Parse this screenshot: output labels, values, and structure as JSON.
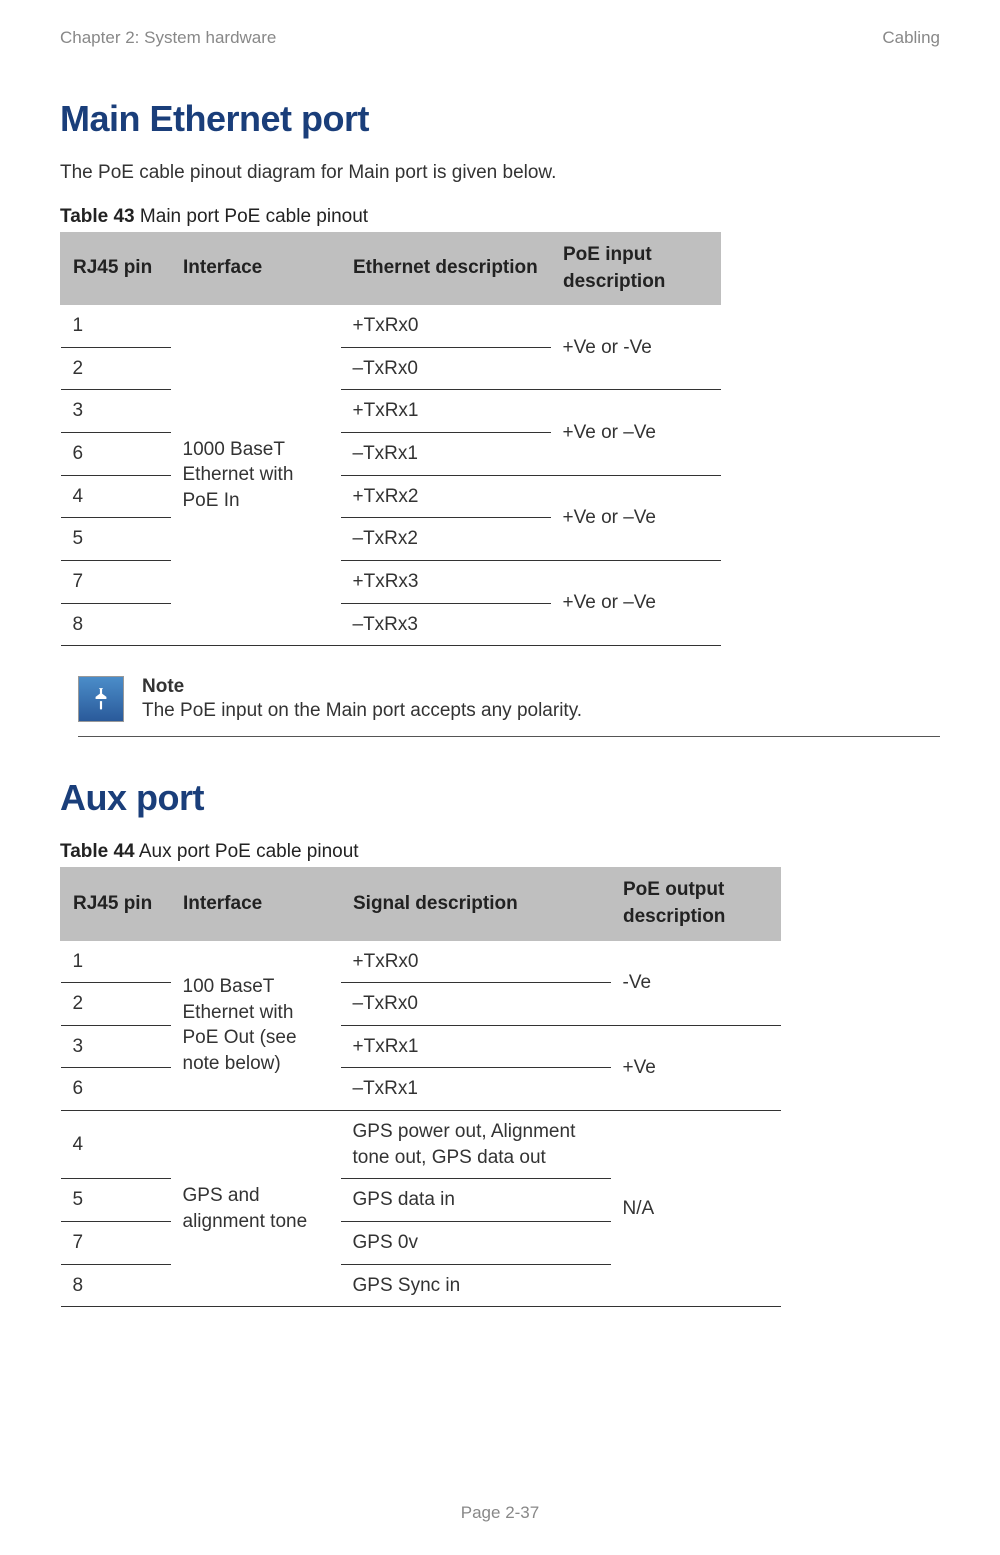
{
  "header": {
    "left": "Chapter 2:  System hardware",
    "right": "Cabling"
  },
  "section1": {
    "title": "Main Ethernet port",
    "intro": "The PoE cable pinout diagram for Main port is given below.",
    "table_caption_bold": "Table 43",
    "table_caption_rest": " Main port PoE cable pinout",
    "headers": {
      "pin": "RJ45 pin",
      "if": "Interface",
      "eth": "Ethernet description",
      "poe": "PoE input description"
    },
    "rows": {
      "pin1": "1",
      "pin2": "2",
      "pin3": "3",
      "pin6": "6",
      "pin4": "4",
      "pin5": "5",
      "pin7": "7",
      "pin8": "8",
      "interface": "1000 BaseT Ethernet with PoE In",
      "eth1": "+TxRx0",
      "eth2": "–TxRx0",
      "eth3": "+TxRx1",
      "eth4": "–TxRx1",
      "eth5": "+TxRx2",
      "eth6": "–TxRx2",
      "eth7": "+TxRx3",
      "eth8": "–TxRx3",
      "poe1": "+Ve or -Ve",
      "poe2": "+Ve or –Ve",
      "poe3": "+Ve or –Ve",
      "poe4": "+Ve or –Ve"
    }
  },
  "note": {
    "title": "Note",
    "body": "The PoE input on the Main port accepts any polarity."
  },
  "section2": {
    "title": "Aux port",
    "table_caption_bold": "Table 44",
    "table_caption_rest": " Aux port PoE cable pinout",
    "headers": {
      "pin": "RJ45 pin",
      "if": "Interface",
      "sig": "Signal description",
      "poe": "PoE output description"
    },
    "rows": {
      "pin1": "1",
      "pin2": "2",
      "pin3": "3",
      "pin6": "6",
      "pin4": "4",
      "pin5": "5",
      "pin7": "7",
      "pin8": "8",
      "interface1": "100 BaseT Ethernet with PoE Out (see note below)",
      "interface2": "GPS and alignment tone",
      "sig1": "+TxRx0",
      "sig2": "–TxRx0",
      "sig3": "+TxRx1",
      "sig4": "–TxRx1",
      "sig5": "GPS power out, Alignment tone out, GPS data out",
      "sig6": "GPS data in",
      "sig7": "GPS 0v",
      "sig8": "GPS Sync in",
      "poe1": "-Ve",
      "poe2": "+Ve",
      "poe3": "N/A"
    }
  },
  "footer": "Page 2-37"
}
